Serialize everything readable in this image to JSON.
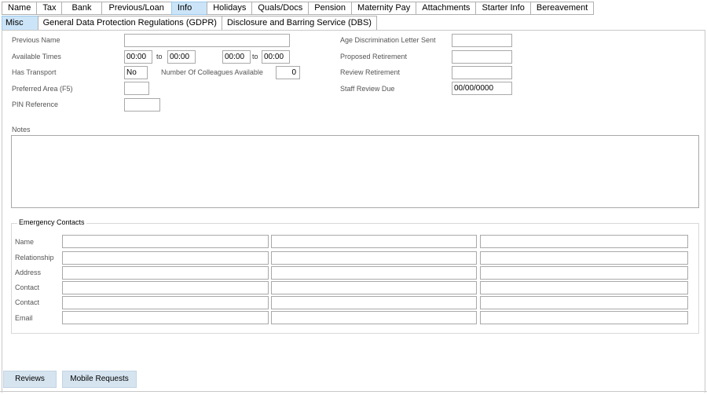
{
  "tabs": [
    "Name",
    "Tax",
    "Bank",
    "Previous/Loan",
    "Info",
    "Holidays",
    "Quals/Docs",
    "Pension",
    "Maternity Pay",
    "Attachments",
    "Starter Info",
    "Bereavement"
  ],
  "active_tab": "Info",
  "subtabs": [
    "Misc",
    "General Data Protection Regulations (GDPR)",
    "Disclosure and Barring Service (DBS)"
  ],
  "active_subtab": "Misc",
  "fields": {
    "previous_name": {
      "label": "Previous Name",
      "value": ""
    },
    "available_times": {
      "label": "Available Times",
      "from1": "00:00",
      "to_label": "to",
      "to1": "00:00",
      "from2": "00:00",
      "to2": "00:00"
    },
    "has_transport": {
      "label": "Has Transport",
      "value": "No"
    },
    "colleagues": {
      "label": "Number Of Colleagues Available",
      "value": "0"
    },
    "preferred_area": {
      "label": "Preferred Area (F5)",
      "value": ""
    },
    "pin_reference": {
      "label": "PIN Reference",
      "value": ""
    },
    "age_letter": {
      "label": "Age Discrimination Letter Sent",
      "value": ""
    },
    "proposed_retirement": {
      "label": "Proposed Retirement",
      "value": ""
    },
    "review_retirement": {
      "label": "Review Retirement",
      "value": ""
    },
    "staff_review_due": {
      "label": "Staff Review Due",
      "value": "00/00/0000"
    }
  },
  "notes": {
    "label": "Notes",
    "value": ""
  },
  "emergency": {
    "title": "Emergency Contacts",
    "rows": [
      "Name",
      "Relationship",
      "Address",
      "Contact",
      "Contact",
      "Email"
    ]
  },
  "buttons": {
    "reviews": "Reviews",
    "mobile_requests": "Mobile Requests"
  }
}
